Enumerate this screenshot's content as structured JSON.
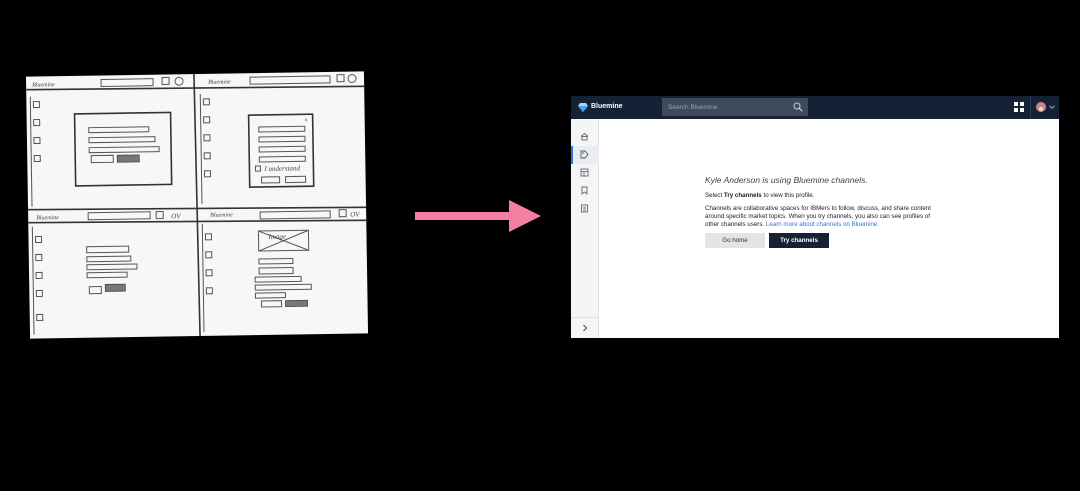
{
  "sketch": {
    "image_label": "Image",
    "checkbox_label": "I understand"
  },
  "app": {
    "brand": "Bluemine",
    "search": {
      "placeholder": "Search Bluemine"
    },
    "main": {
      "headline": "Kyle Anderson is using Bluemine channels.",
      "select_prefix": "Select ",
      "select_bold": "Try channels",
      "select_suffix": " to view this profile.",
      "description": "Channels are collaborative spaces for IBMers to follow, discuss, and share content around specific market topics. When you try channels, you also can see profiles of other channels users. ",
      "learn_more_link": "Learn more about channels on Bluemine.",
      "go_home_label": "Go home",
      "try_channels_label": "Try channels"
    },
    "icons": {
      "logo": "diamond-logo-icon",
      "search": "search-icon",
      "grid": "app-grid-icon",
      "avatar": "user-avatar",
      "chevron": "chevron-down-icon",
      "sidebar": [
        "home-icon",
        "tag-icon",
        "list-icon",
        "bookmark-icon",
        "document-icon"
      ],
      "expand": "chevron-right-icon"
    },
    "colors": {
      "topbar": "#152236",
      "accent": "#3b73d9",
      "arrow": "#f47fa2"
    }
  }
}
